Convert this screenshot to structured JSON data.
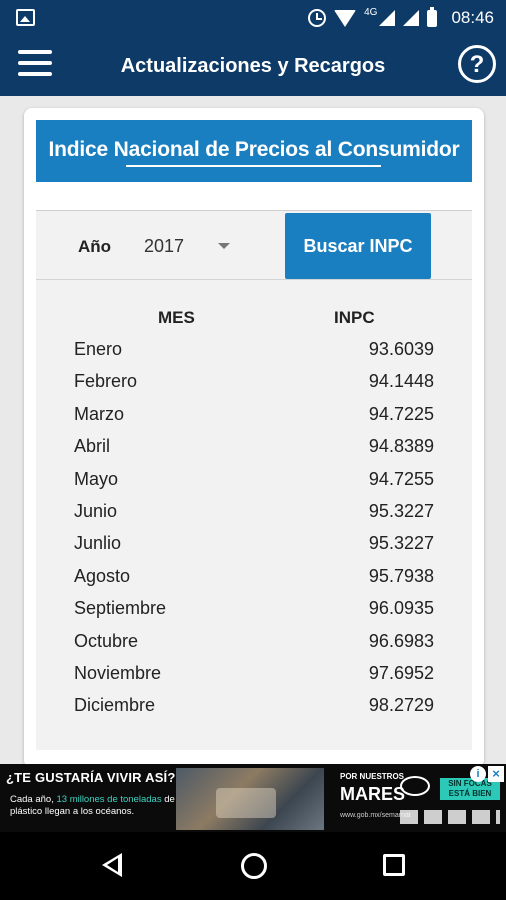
{
  "status_bar": {
    "network_label": "4G",
    "time": "08:46"
  },
  "app_bar": {
    "title": "Actualizaciones y Recargos",
    "help_label": "?"
  },
  "banner": {
    "heading": "Indice Nacional de Precios al Consumidor"
  },
  "search": {
    "year_label": "Año",
    "year_value": "2017",
    "button_label": "Buscar INPC"
  },
  "table": {
    "headers": [
      "MES",
      "INPC"
    ],
    "rows": [
      {
        "mes": "Enero",
        "inpc": "93.6039"
      },
      {
        "mes": "Febrero",
        "inpc": "94.1448"
      },
      {
        "mes": "Marzo",
        "inpc": "94.7225"
      },
      {
        "mes": "Abril",
        "inpc": "94.8389"
      },
      {
        "mes": "Mayo",
        "inpc": "94.7255"
      },
      {
        "mes": "Junio",
        "inpc": "95.3227"
      },
      {
        "mes": "Junlio",
        "inpc": "95.3227"
      },
      {
        "mes": "Agosto",
        "inpc": "95.7938"
      },
      {
        "mes": "Septiembre",
        "inpc": "96.0935"
      },
      {
        "mes": "Octubre",
        "inpc": "96.6983"
      },
      {
        "mes": "Noviembre",
        "inpc": "97.6952"
      },
      {
        "mes": "Diciembre",
        "inpc": "98.2729"
      }
    ]
  },
  "ad": {
    "headline": "¿TE GUSTARÍA VIVIR ASÍ?",
    "sub_prefix": "Cada año,",
    "sub_accent": "13 millones de toneladas",
    "sub_suffix": "de plástico llegan a los océanos.",
    "campaign_small": "POR NUESTROS",
    "campaign_big": "MARES",
    "flap_text": "SIN FOCAS ESTÁ BIEN",
    "url": "www.gob.mx/semarnat"
  }
}
